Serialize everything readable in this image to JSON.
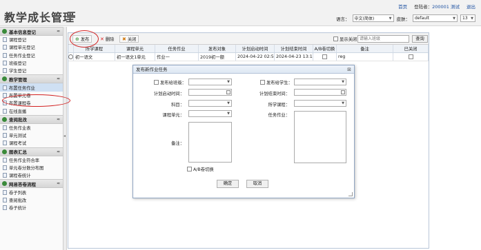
{
  "header": {
    "title": "教学成长管理",
    "links": {
      "home": "首页",
      "login_label": "登陆者：",
      "login_user": "200001 测试",
      "logout": "退出"
    },
    "language_label": "语言：",
    "language_value": "中文(简体)",
    "skin_label": "皮肤：",
    "skin_value": "default",
    "font_value": "13"
  },
  "sidebar": {
    "groups": [
      {
        "title": "基本信息登记",
        "items": [
          "课程登记",
          "课程单元登记",
          "任务作业登记",
          "班级登记",
          "学生登记"
        ]
      },
      {
        "title": "教学管理",
        "items": [
          "布置任务作业",
          "布置单元卷",
          "布置课程卷",
          "在线直播"
        ]
      },
      {
        "title": "查阅批改",
        "items": [
          "任务作业表",
          "单元测试",
          "课程考试"
        ]
      },
      {
        "title": "图表汇总",
        "items": [
          "任务作业符合率",
          "单元卷分数分布图",
          "课程卷统计"
        ]
      },
      {
        "title": "网易答卷流程",
        "items": [
          "卷子列表",
          "查阅批改",
          "卷子统计"
        ]
      }
    ]
  },
  "toolbar": {
    "publish": "发布",
    "delete": "删除",
    "close": "关闭",
    "show_closed": "显示关闭",
    "search_placeholder": "请输入班级",
    "query": "查询"
  },
  "grid": {
    "columns": [
      "所学课程",
      "课程单元",
      "任务作业",
      "发布对象",
      "计划启动时间",
      "计划结束时间",
      "A/B卷切换",
      "备注",
      "已关闭"
    ],
    "rows": [
      {
        "course": "初一语文",
        "unit": "初一语文1单元",
        "task": "作业一",
        "target": "2019初一额",
        "start": "2024-04-22 02:54",
        "end": "2024-04-23 13:15",
        "remark": "reg"
      }
    ]
  },
  "modal": {
    "title": "发布新作业任务",
    "publish_class": "发布给班级：",
    "publish_student": "发布给学生：",
    "plan_start": "计划启动时间：",
    "plan_end": "计划结束时间：",
    "subject": "科目：",
    "course": "所学课程：",
    "unit": "课程单元：",
    "task": "任务作业：",
    "remark": "备注：",
    "ab_switch": "A/B卷切换",
    "ok": "确定",
    "cancel": "取消"
  }
}
